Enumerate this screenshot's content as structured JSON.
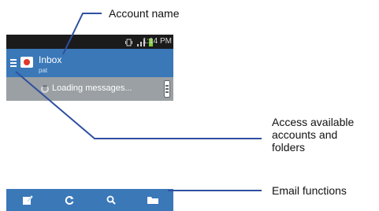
{
  "status_bar": {
    "time": "1:14 PM"
  },
  "action_bar": {
    "title": "Inbox",
    "account": "pat"
  },
  "loading": {
    "text": "Loading messages..."
  },
  "callouts": {
    "account_name": "Account name",
    "access_accounts": [
      "Access available",
      "accounts and",
      "folders"
    ],
    "email_functions": "Email functions"
  },
  "bottom_bar": {
    "buttons": [
      "compose-icon",
      "refresh-icon",
      "search-icon",
      "folder-icon"
    ]
  },
  "colors": {
    "action_bar": "#3a78b8",
    "callout_line": "#2f4fa0",
    "loading_bar": "#9aa0a3"
  }
}
